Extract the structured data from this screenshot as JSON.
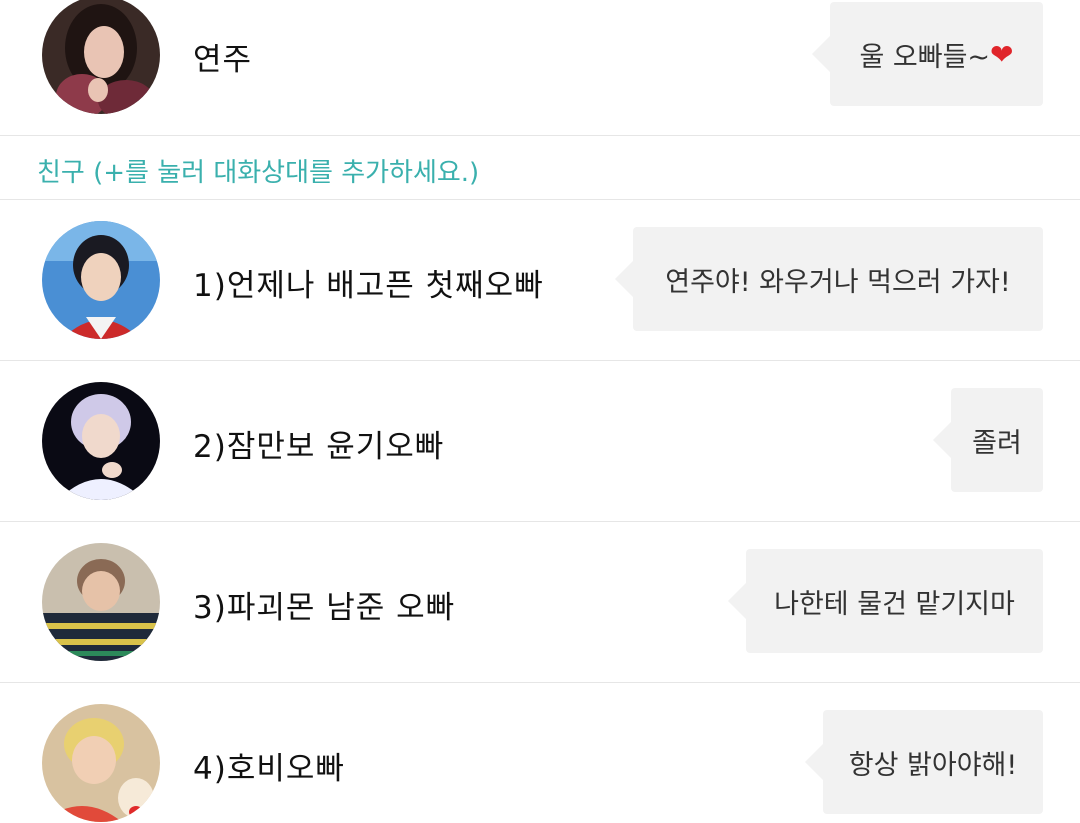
{
  "profile": {
    "name": "연주",
    "status_text": "울 오빠들~",
    "status_emoji": "❤"
  },
  "section_header": "친구 (+를 눌러 대화상대를 추가하세요.)",
  "friends": [
    {
      "name": "1)언제나 배고픈 첫째오빠",
      "status": "연주야! 와우거나 먹으러 가자!"
    },
    {
      "name": "2)잠만보 윤기오빠",
      "status": "졸려"
    },
    {
      "name": "3)파괴몬 남준 오빠",
      "status": "나한테 물건 맡기지마"
    },
    {
      "name": "4)호비오빠",
      "status": "항상 밝아야해!"
    }
  ],
  "colors": {
    "accent": "#3ab0ad",
    "bubble": "#f2f2f2",
    "heart": "#e0252b",
    "divider": "#e6e6e6"
  }
}
